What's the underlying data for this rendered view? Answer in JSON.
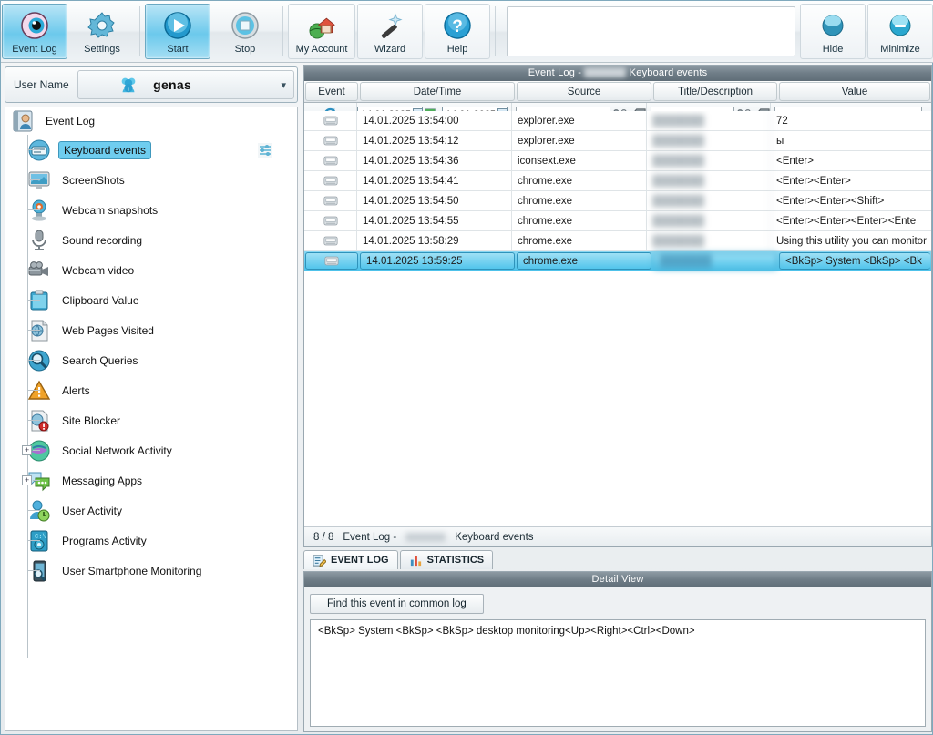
{
  "toolbar": {
    "buttons": [
      {
        "label": "Event Log",
        "icon": "eye-icon",
        "selected": true
      },
      {
        "label": "Settings",
        "icon": "gear-icon",
        "selected": false
      },
      {
        "label": "Start",
        "icon": "play-icon",
        "selected": true
      },
      {
        "label": "Stop",
        "icon": "stop-icon",
        "selected": false
      },
      {
        "label": "My Account",
        "icon": "home-globe-icon",
        "selected": false
      },
      {
        "label": "Wizard",
        "icon": "magic-wand-icon",
        "selected": false
      },
      {
        "label": "Help",
        "icon": "question-mark-icon",
        "selected": false
      }
    ],
    "right_buttons": [
      {
        "label": "Hide",
        "icon": "hide-sphere-icon"
      },
      {
        "label": "Minimize",
        "icon": "minimize-sphere-icon"
      }
    ],
    "search_value": "",
    "search_placeholder": ""
  },
  "sidebar": {
    "user_label": "User Name",
    "user_name": "genas",
    "root": {
      "label": "Event Log",
      "icon": "notebook-user-icon"
    },
    "items": [
      {
        "label": "Keyboard events",
        "icon": "keyboard-icon",
        "selected": true,
        "expandable": false,
        "has_settings": true
      },
      {
        "label": "ScreenShots",
        "icon": "monitor-icon",
        "selected": false,
        "expandable": false
      },
      {
        "label": "Webcam snapshots",
        "icon": "webcam-icon",
        "selected": false,
        "expandable": false
      },
      {
        "label": "Sound recording",
        "icon": "microphone-icon",
        "selected": false,
        "expandable": false
      },
      {
        "label": "Webcam video",
        "icon": "videocamera-icon",
        "selected": false,
        "expandable": false
      },
      {
        "label": "Clipboard Value",
        "icon": "clipboard-icon",
        "selected": false,
        "expandable": false
      },
      {
        "label": "Web Pages Visited",
        "icon": "webpage-globe-icon",
        "selected": false,
        "expandable": false
      },
      {
        "label": "Search Queries",
        "icon": "magnifier-icon",
        "selected": false,
        "expandable": false
      },
      {
        "label": "Alerts",
        "icon": "warning-triangle-icon",
        "selected": false,
        "expandable": false
      },
      {
        "label": "Site Blocker",
        "icon": "globe-block-icon",
        "selected": false,
        "expandable": false
      },
      {
        "label": "Social Network Activity",
        "icon": "social-network-icon",
        "selected": false,
        "expandable": true
      },
      {
        "label": "Messaging Apps",
        "icon": "chat-bubbles-icon",
        "selected": false,
        "expandable": true
      },
      {
        "label": "User Activity",
        "icon": "user-clock-icon",
        "selected": false,
        "expandable": false
      },
      {
        "label": "Programs Activity",
        "icon": "programs-icon",
        "selected": false,
        "expandable": false
      },
      {
        "label": "User Smartphone Monitoring",
        "icon": "smartphone-icon",
        "selected": false,
        "expandable": false
      }
    ]
  },
  "grid": {
    "title_prefix": "Event Log -",
    "title_suffix": "Keyboard events",
    "columns": [
      "Event",
      "Date/Time",
      "Source",
      "Title/Description",
      "Value"
    ],
    "filter": {
      "refresh_icon": "refresh-icon",
      "date_from": "14.01.2025",
      "date_to": "14.01.2025",
      "between_icon": "date-range-icon",
      "source_filter": "",
      "title_filter": "",
      "value_filter": "",
      "find_icon": "binoculars-icon",
      "clear_icon": "erase-icon"
    },
    "rows": [
      {
        "icon": "keyboard-icon",
        "datetime": "14.01.2025 13:54:00",
        "source": "explorer.exe",
        "title": "",
        "value": "72",
        "selected": false
      },
      {
        "icon": "keyboard-icon",
        "datetime": "14.01.2025 13:54:12",
        "source": "explorer.exe",
        "title": "",
        "value": "ы",
        "selected": false
      },
      {
        "icon": "keyboard-icon",
        "datetime": "14.01.2025 13:54:36",
        "source": "iconsext.exe",
        "title": "",
        "value": "<Enter>",
        "selected": false
      },
      {
        "icon": "keyboard-icon",
        "datetime": "14.01.2025 13:54:41",
        "source": "chrome.exe",
        "title": "",
        "value": "<Enter><Enter>",
        "selected": false
      },
      {
        "icon": "keyboard-icon",
        "datetime": "14.01.2025 13:54:50",
        "source": "chrome.exe",
        "title": "",
        "value": "<Enter><Enter><Shift>",
        "selected": false
      },
      {
        "icon": "keyboard-icon",
        "datetime": "14.01.2025 13:54:55",
        "source": "chrome.exe",
        "title": "",
        "value": "<Enter><Enter><Enter><Ente",
        "selected": false
      },
      {
        "icon": "keyboard-icon",
        "datetime": "14.01.2025 13:58:29",
        "source": "chrome.exe",
        "title": "",
        "value": "Using this utility you can monitor",
        "selected": false
      },
      {
        "icon": "keyboard-icon",
        "datetime": "14.01.2025 13:59:25",
        "source": "chrome.exe",
        "title": "",
        "value": "<BkSp>  System     <BkSp>  <Bk",
        "selected": true
      }
    ],
    "status_count": "8 / 8",
    "status_prefix": "Event Log -",
    "status_suffix": "Keyboard events"
  },
  "tabs": [
    {
      "label": "EVENT LOG",
      "icon": "event-log-icon",
      "active": true
    },
    {
      "label": "STATISTICS",
      "icon": "bar-chart-icon",
      "active": false
    }
  ],
  "detail": {
    "title": "Detail View",
    "find_button": "Find this event in common log",
    "content": "<BkSp>  System      <BkSp>  <BkSp> desktop  monitoring<Up><Right><Ctrl><Down>"
  },
  "colors": {
    "accent": "#4dc2ea",
    "selection": "#6fcdef",
    "panel_title": "#6f7d87",
    "window_border": "#7fa9bd"
  }
}
